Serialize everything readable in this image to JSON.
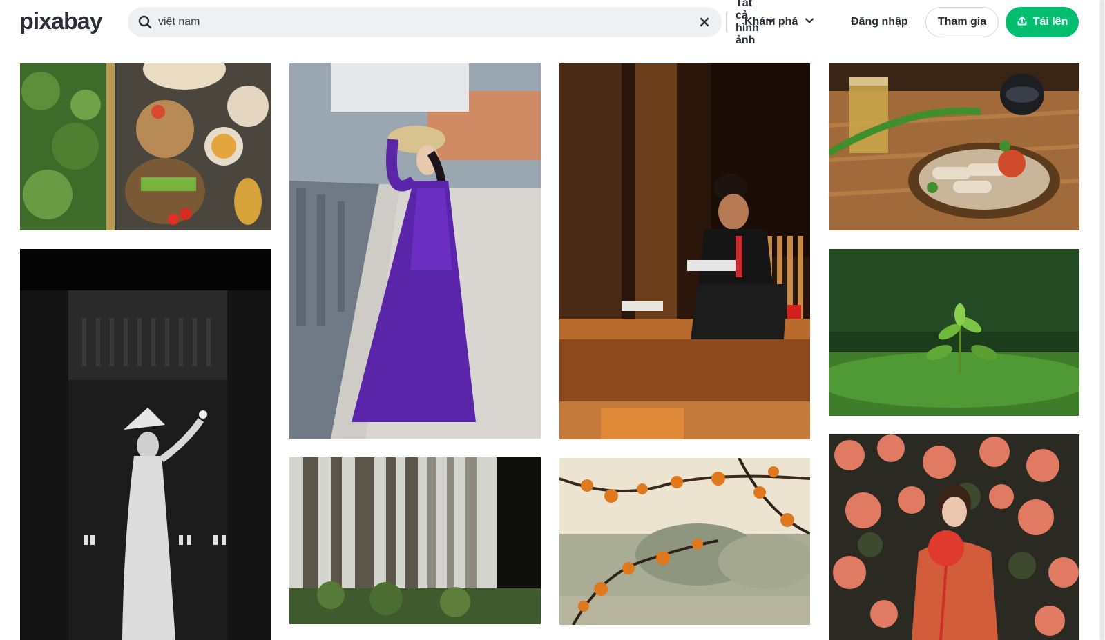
{
  "brand": {
    "logo_text": "pixabay",
    "accent_color": "#02be6e"
  },
  "search": {
    "value": "việt nam",
    "search_icon": "search-icon",
    "clear_icon": "close-icon",
    "type_filter": "Tất cả hình ảnh",
    "type_filter_icon": "chevron-down-icon"
  },
  "nav": {
    "explore_label": "Khám phá",
    "explore_icon": "chevron-down-icon",
    "login_label": "Đăng nhập",
    "join_label": "Tham gia",
    "upload_label": "Tải lên",
    "upload_icon": "upload-icon"
  },
  "results": [
    {
      "subject": "vietnamese-food-ingredients-photo"
    },
    {
      "subject": "ao-dai-woman-black-white-photo"
    },
    {
      "subject": "purple-ao-dai-woman-photo"
    },
    {
      "subject": "misty-forest-trees-photo"
    },
    {
      "subject": "man-reading-on-porch-photo"
    },
    {
      "subject": "orange-leaves-branches-photo"
    },
    {
      "subject": "spring-rolls-tea-photo"
    },
    {
      "subject": "tea-leaves-field-photo"
    },
    {
      "subject": "woman-red-flowers-photo"
    }
  ]
}
